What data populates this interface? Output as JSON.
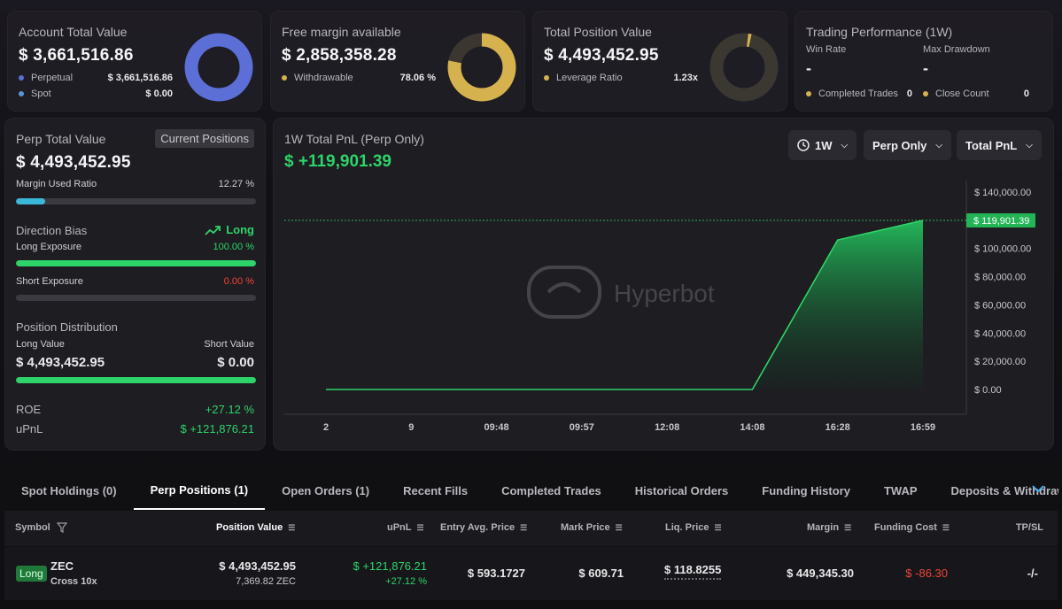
{
  "cards": {
    "account": {
      "title": "Account Total Value",
      "value": "$ 3,661,516.86",
      "rows": [
        {
          "label": "Perpetual",
          "value": "$ 3,661,516.86",
          "color": "#5b6fd6"
        },
        {
          "label": "Spot",
          "value": "$ 0.00",
          "color": "#5b93d6"
        }
      ],
      "donut_color": "#5b6fd6"
    },
    "margin": {
      "title": "Free margin available",
      "value": "$ 2,858,358.28",
      "row": {
        "label": "Withdrawable",
        "value": "78.06 %",
        "color": "#d6b24f"
      },
      "donut_fraction": 0.7806,
      "donut_color": "#d6b24f"
    },
    "position": {
      "title": "Total Position Value",
      "value": "$ 4,493,452.95",
      "row": {
        "label": "Leverage Ratio",
        "value": "1.23x",
        "color": "#d6b24f"
      },
      "donut_color": "#d6b24f"
    },
    "performance": {
      "title": "Trading Performance (1W)",
      "win_rate_label": "Win Rate",
      "win_rate_value": "-",
      "max_drawdown_label": "Max Drawdown",
      "max_drawdown_value": "-",
      "completed_label": "Completed Trades",
      "completed_value": "0",
      "close_label": "Close Count",
      "close_value": "0",
      "dot_color": "#d6b24f"
    }
  },
  "perp": {
    "title": "Perp Total Value",
    "current_positions_label": "Current Positions",
    "value": "$ 4,493,452.95",
    "margin_used_label": "Margin Used Ratio",
    "margin_used_value": "12.27 %",
    "margin_used_fraction": 0.1227,
    "direction_label": "Direction Bias",
    "direction_value": "Long",
    "long_exposure_label": "Long Exposure",
    "long_exposure_value": "100.00 %",
    "long_exposure_fraction": 1.0,
    "short_exposure_label": "Short Exposure",
    "short_exposure_value": "0.00 %",
    "short_exposure_fraction": 0.0,
    "distribution_label": "Position Distribution",
    "long_value_label": "Long Value",
    "long_value": "$ 4,493,452.95",
    "short_value_label": "Short Value",
    "short_value": "$ 0.00",
    "distribution_long_fraction": 1.0,
    "roe_label": "ROE",
    "roe_value": "+27.12 %",
    "upnl_label": "uPnL",
    "upnl_value": "$ +121,876.21"
  },
  "pnl": {
    "title": "1W Total PnL (Perp Only)",
    "value": "$ +119,901.39",
    "period": "1W",
    "scope": "Perp Only",
    "metric": "Total PnL",
    "watermark": "Hyperbot"
  },
  "chart_data": {
    "type": "area",
    "x": [
      "2",
      "9",
      "09:48",
      "09:57",
      "12:08",
      "14:08",
      "16:28",
      "16:59"
    ],
    "values": [
      0,
      0,
      0,
      0,
      0,
      0,
      106000,
      119901.39
    ],
    "ylim": [
      0,
      150000
    ],
    "yticks": [
      "$ 0.00",
      "$ 20,000.00",
      "$ 40,000.00",
      "$ 60,000.00",
      "$ 80,000.00",
      "$ 100,000.00",
      "$ 140,000.00"
    ],
    "ytick_values": [
      0,
      20000,
      40000,
      60000,
      80000,
      100000,
      140000
    ],
    "last_label": "$ 119,901.39",
    "last_value": 119901.39,
    "color": "#2dd469"
  },
  "tabs": [
    "Spot Holdings (0)",
    "Perp Positions (1)",
    "Open Orders (1)",
    "Recent Fills",
    "Completed Trades",
    "Historical Orders",
    "Funding History",
    "TWAP",
    "Deposits & Withdraw"
  ],
  "table": {
    "headers": {
      "symbol": "Symbol",
      "position_value": "Position Value",
      "upnl": "uPnL",
      "entry": "Entry Avg. Price",
      "mark": "Mark Price",
      "liq": "Liq. Price",
      "margin": "Margin",
      "funding": "Funding Cost",
      "tpsl": "TP/SL"
    },
    "rows": [
      {
        "side": "Long",
        "symbol": "ZEC",
        "mode": "Cross 10x",
        "position_value": "$ 4,493,452.95",
        "position_size": "7,369.82 ZEC",
        "upnl": "$ +121,876.21",
        "upnl_pct": "+27.12 %",
        "entry": "$ 593.1727",
        "mark": "$ 609.71",
        "liq": "$ 118.8255",
        "margin": "$ 449,345.30",
        "funding": "$ -86.30",
        "tpsl": "-/-"
      }
    ]
  }
}
